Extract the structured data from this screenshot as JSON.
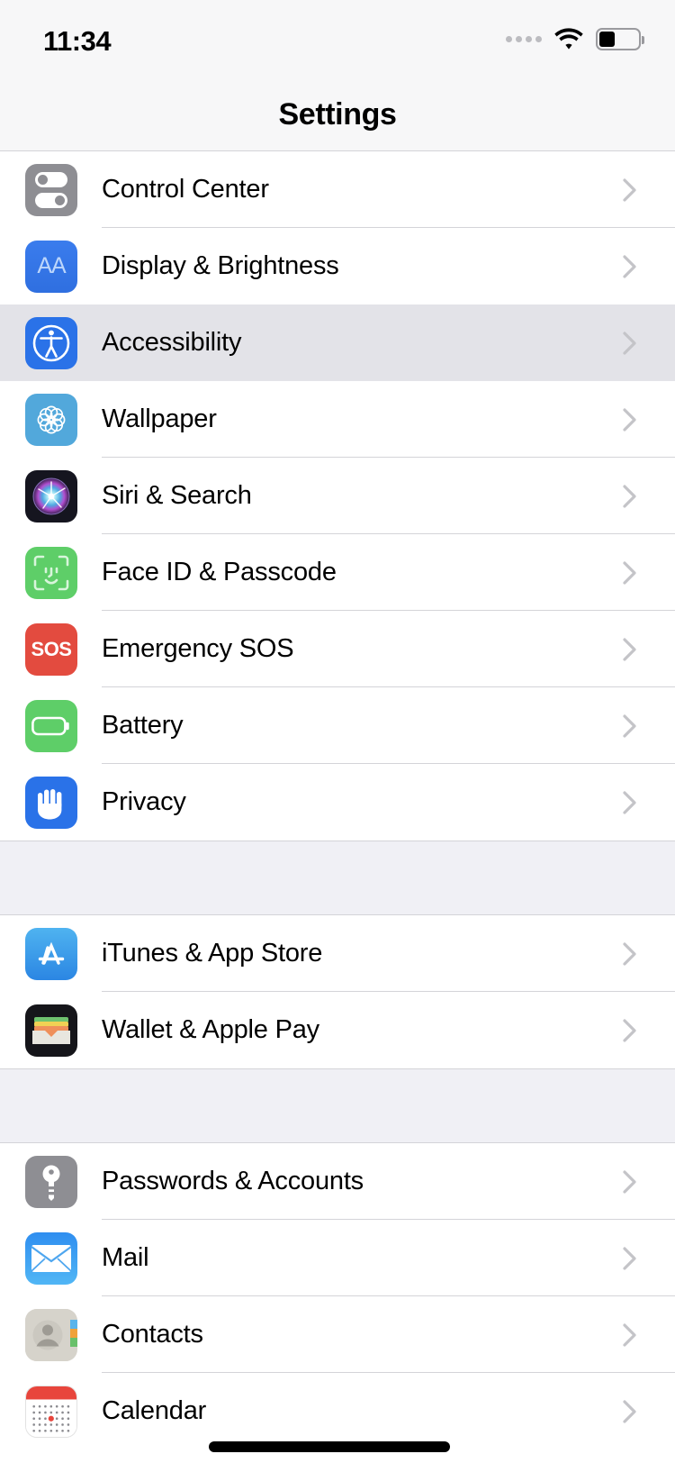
{
  "status_bar": {
    "time": "11:34",
    "signal_icon": "signal-dots-icon",
    "wifi_icon": "wifi-icon",
    "battery_icon": "battery-icon",
    "battery_level_percent": 40
  },
  "header": {
    "title": "Settings"
  },
  "colors": {
    "accent_blue": "#2a72e8",
    "gray_icon": "#8e8e93",
    "green": "#5ece68",
    "red": "#e34b3f",
    "selected_row": "#e3e3e8",
    "group_gap": "#f0f0f5",
    "separator": "#d4d4d8",
    "chevron": "#c4c4c8"
  },
  "groups": [
    {
      "rows": [
        {
          "label": "Control Center",
          "icon": "control-center-icon",
          "selected": false
        },
        {
          "label": "Display & Brightness",
          "icon": "display-brightness-icon",
          "selected": false
        },
        {
          "label": "Accessibility",
          "icon": "accessibility-icon",
          "selected": true
        },
        {
          "label": "Wallpaper",
          "icon": "wallpaper-icon",
          "selected": false
        },
        {
          "label": "Siri & Search",
          "icon": "siri-search-icon",
          "selected": false
        },
        {
          "label": "Face ID & Passcode",
          "icon": "face-id-icon",
          "selected": false
        },
        {
          "label": "Emergency SOS",
          "icon": "emergency-sos-icon",
          "selected": false
        },
        {
          "label": "Battery",
          "icon": "battery-settings-icon",
          "selected": false
        },
        {
          "label": "Privacy",
          "icon": "privacy-icon",
          "selected": false
        }
      ]
    },
    {
      "rows": [
        {
          "label": "iTunes & App Store",
          "icon": "app-store-icon",
          "selected": false
        },
        {
          "label": "Wallet & Apple Pay",
          "icon": "wallet-icon",
          "selected": false
        }
      ]
    },
    {
      "rows": [
        {
          "label": "Passwords & Accounts",
          "icon": "passwords-accounts-icon",
          "selected": false
        },
        {
          "label": "Mail",
          "icon": "mail-icon",
          "selected": false
        },
        {
          "label": "Contacts",
          "icon": "contacts-icon",
          "selected": false
        },
        {
          "label": "Calendar",
          "icon": "calendar-icon",
          "selected": false
        }
      ]
    }
  ],
  "chevron_glyph": "chevron-right-icon",
  "home_indicator": "home-indicator"
}
